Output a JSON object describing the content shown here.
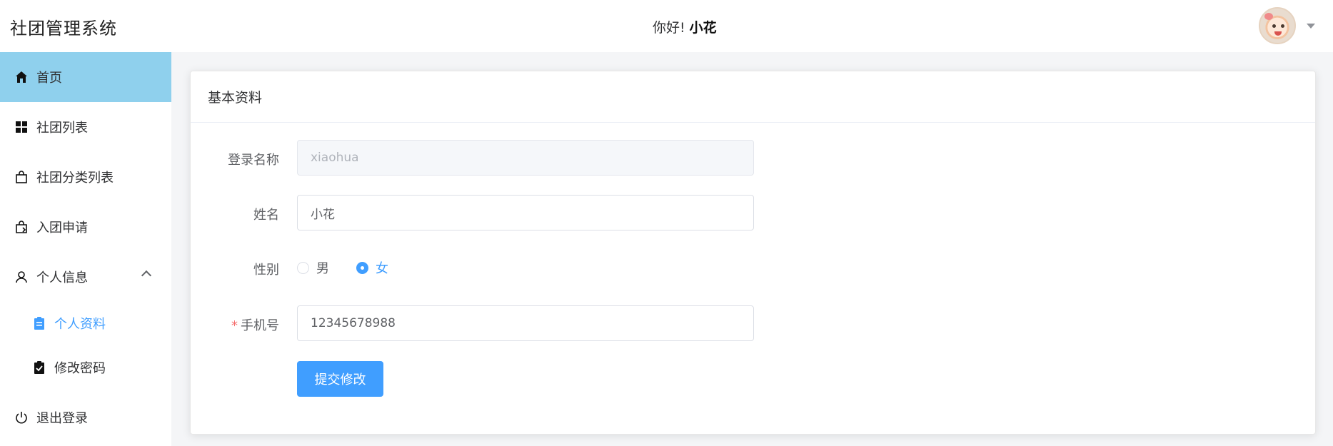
{
  "header": {
    "app_title": "社团管理系统",
    "greeting_prefix": "你好!",
    "user_name": "小花"
  },
  "sidebar": {
    "items": [
      {
        "label": "首页",
        "icon": "home-icon",
        "active": true
      },
      {
        "label": "社团列表",
        "icon": "grid-icon"
      },
      {
        "label": "社团分类列表",
        "icon": "bag-icon"
      },
      {
        "label": "入团申请",
        "icon": "bag-return-icon"
      },
      {
        "label": "个人信息",
        "icon": "user-icon",
        "expanded": true
      }
    ],
    "submenu": [
      {
        "label": "个人资料",
        "icon": "clipboard-icon",
        "active": true
      },
      {
        "label": "修改密码",
        "icon": "clipboard-check-icon"
      }
    ],
    "logout": {
      "label": "退出登录",
      "icon": "power-icon"
    }
  },
  "card": {
    "title": "基本资料",
    "fields": {
      "login_name": {
        "label": "登录名称",
        "value": "xiaohua",
        "disabled": true
      },
      "name": {
        "label": "姓名",
        "value": "小花"
      },
      "gender": {
        "label": "性别",
        "options": [
          "男",
          "女"
        ],
        "selected": "女"
      },
      "phone": {
        "label": "手机号",
        "value": "12345678988",
        "required": true,
        "required_mark": "*"
      }
    },
    "submit_label": "提交修改"
  },
  "colors": {
    "accent": "#409eff",
    "sidebar_active": "#8fd0ed",
    "required": "#f56c6c"
  }
}
